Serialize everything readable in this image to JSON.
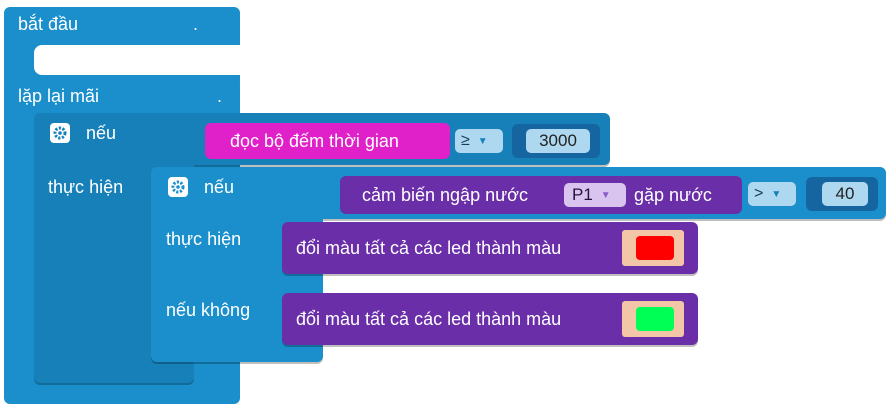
{
  "workspace": {
    "start_block": {
      "label": "bắt đầu",
      "dot": "."
    },
    "loop_block": {
      "label": "lặp lại mãi",
      "dot": "."
    },
    "outer_if": {
      "if_label": "nếu",
      "then_label": "thực hiện",
      "condition": {
        "left_block": "đọc bộ đếm thời gian",
        "operator": "≥",
        "right_value": "3000"
      }
    },
    "inner_if": {
      "if_label": "nếu",
      "then_label": "thực hiện",
      "else_label": "nếu không",
      "condition": {
        "sensor_prefix": "cảm biến ngập nước",
        "port": "P1",
        "sensor_suffix": "gặp nước",
        "operator": ">",
        "right_value": "40"
      }
    },
    "then_action": {
      "label": "đổi màu tất cả các led thành màu",
      "color": "#FF0000"
    },
    "else_action": {
      "label": "đổi màu tất cả các led thành màu",
      "color": "#00FF55"
    }
  },
  "icons": {
    "gear": "gear-icon",
    "dropdown": "dropdown-arrow-icon"
  },
  "colors": {
    "control_block": "#1A8FCB",
    "timer_block": "#E020C8",
    "sensor_block": "#6A2FA8",
    "led_block": "#6A2FA8",
    "color_swatch_bg": "#F4C6A8"
  }
}
